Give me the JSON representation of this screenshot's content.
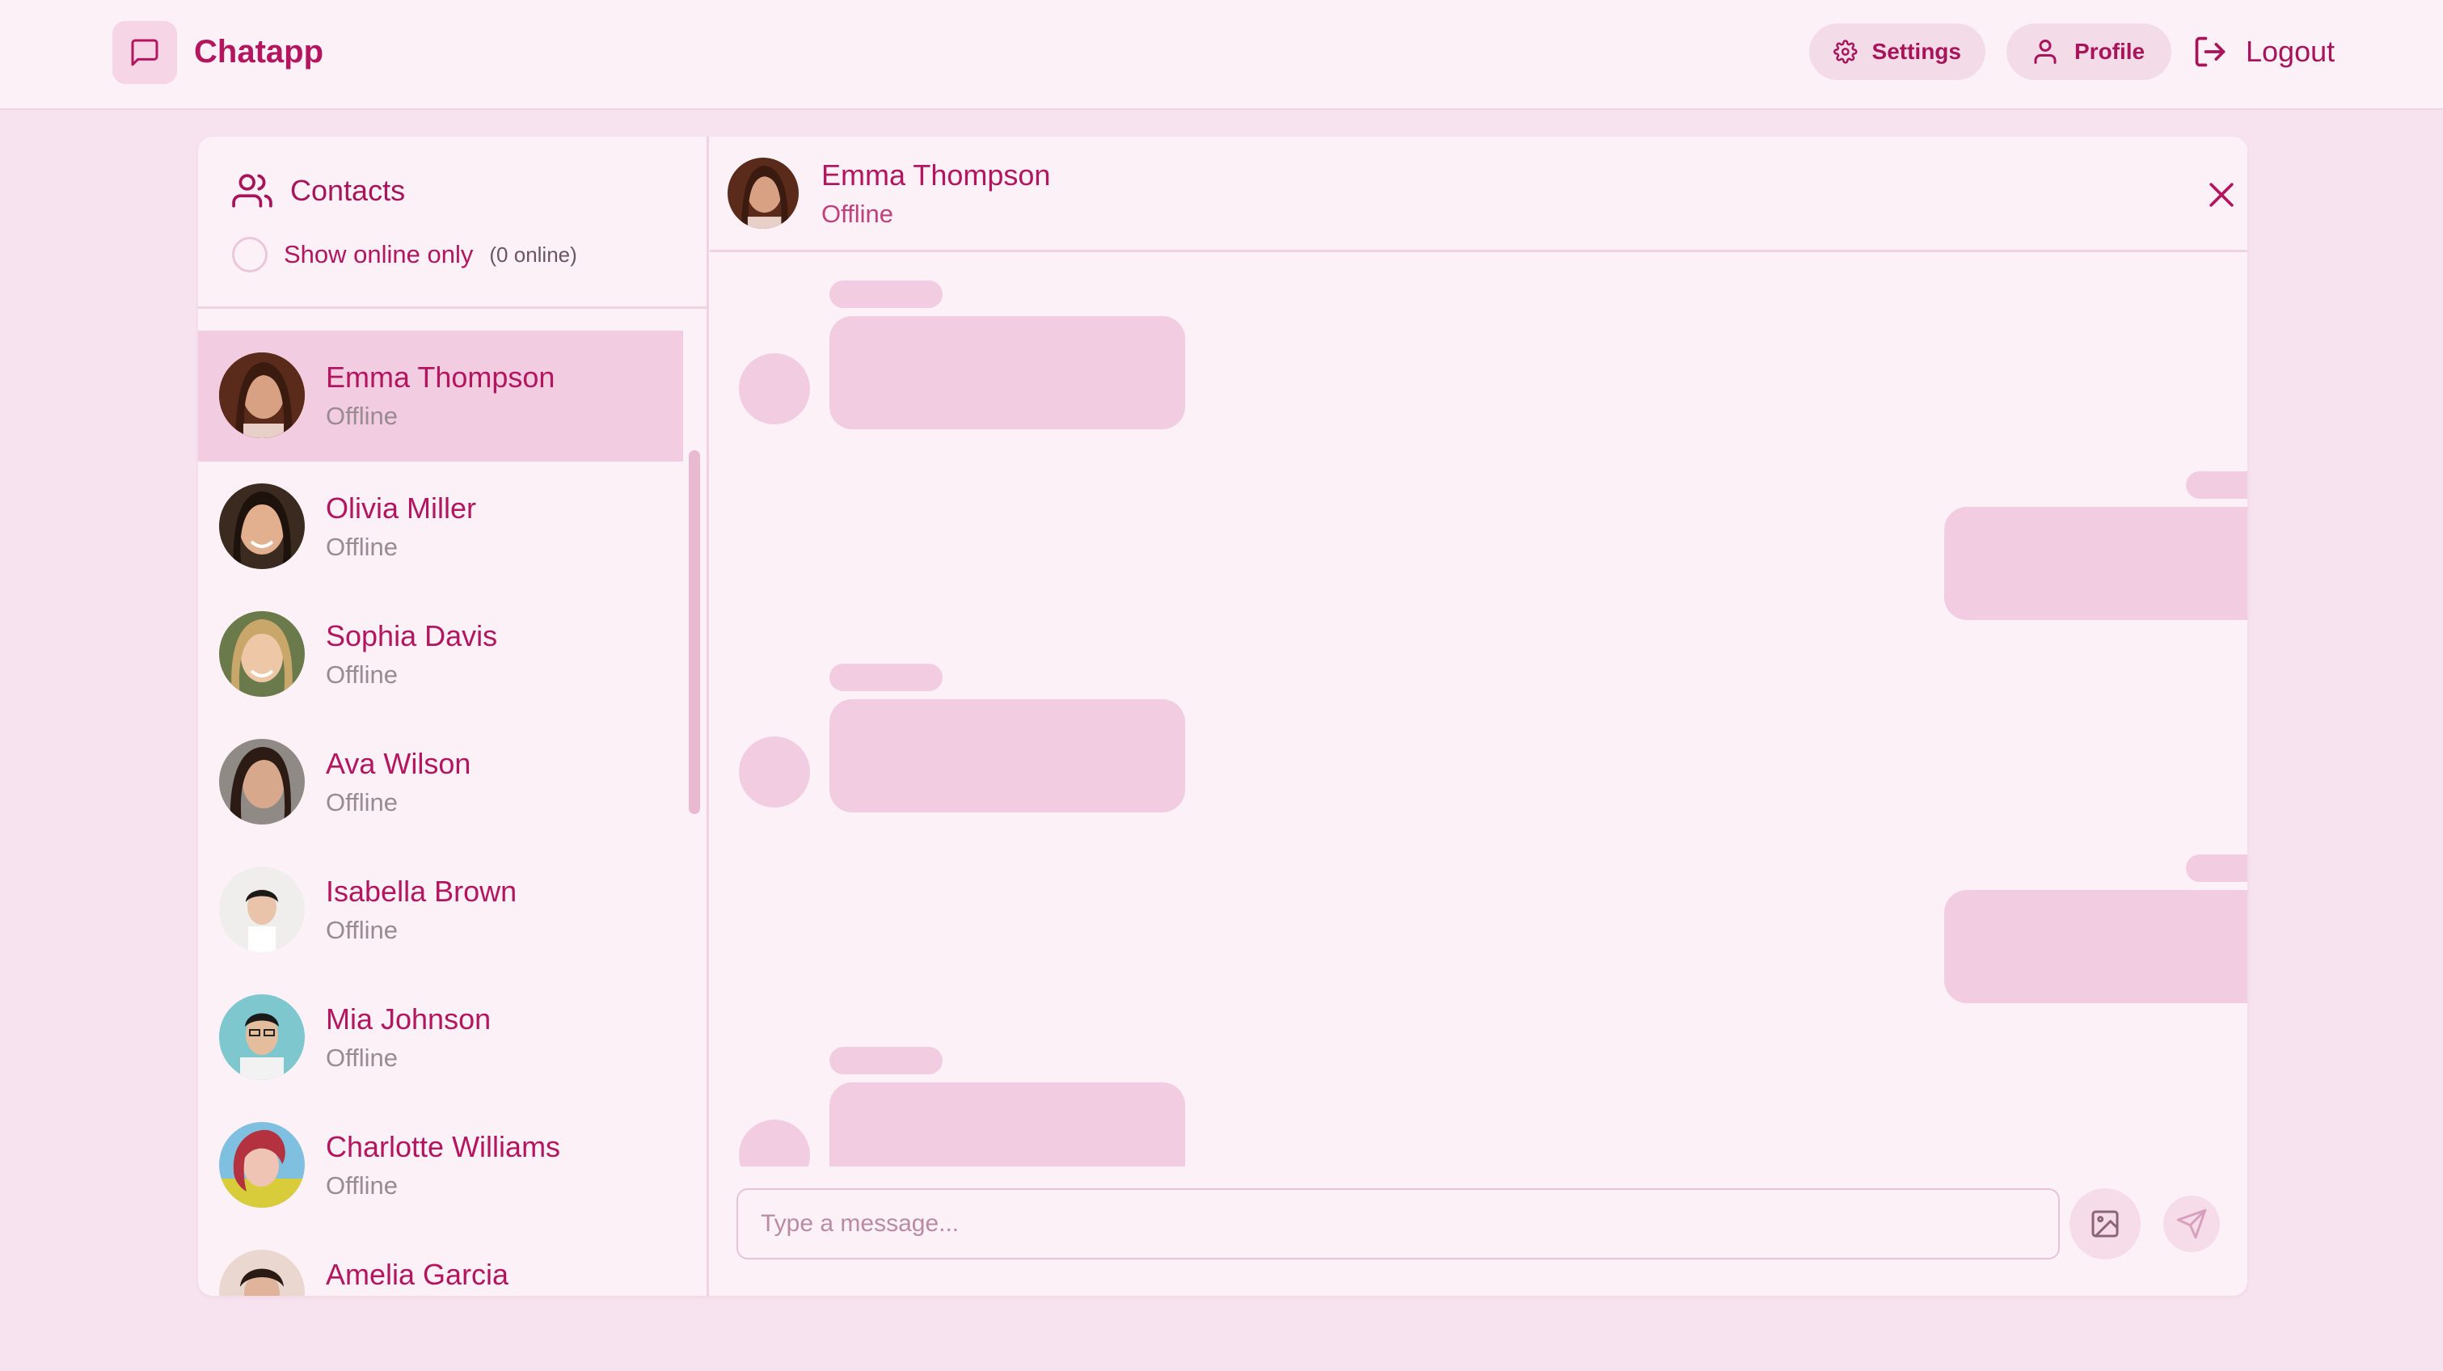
{
  "app": {
    "name": "Chatapp"
  },
  "nav": {
    "settings": "Settings",
    "profile": "Profile",
    "logout": "Logout"
  },
  "sidebar": {
    "title": "Contacts",
    "filter_label": "Show online only",
    "online_count": "(0 online)",
    "contacts": [
      {
        "name": "Emma Thompson",
        "status": "Offline",
        "active": true
      },
      {
        "name": "Olivia Miller",
        "status": "Offline"
      },
      {
        "name": "Sophia Davis",
        "status": "Offline"
      },
      {
        "name": "Ava Wilson",
        "status": "Offline"
      },
      {
        "name": "Isabella Brown",
        "status": "Offline"
      },
      {
        "name": "Mia Johnson",
        "status": "Offline"
      },
      {
        "name": "Charlotte Williams",
        "status": "Offline"
      },
      {
        "name": "Amelia Garcia",
        "status": ""
      }
    ]
  },
  "chat": {
    "contact_name": "Emma Thompson",
    "contact_status": "Offline",
    "input_placeholder": "Type a message..."
  },
  "colors": {
    "accent": "#b3155f",
    "background": "#f6e3ef",
    "panel": "#fcf1f7",
    "skeleton": "#f2cde2"
  }
}
